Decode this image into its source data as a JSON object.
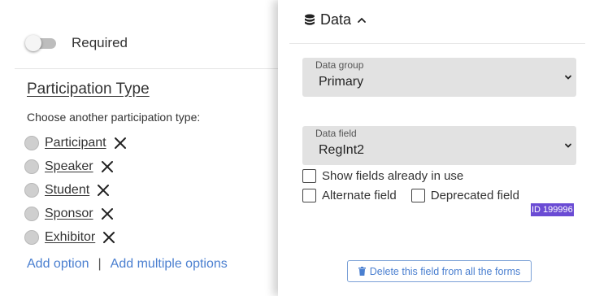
{
  "left_panel": {
    "required_label": "Required",
    "required_on": false,
    "section_title": "Participation Type",
    "hint": "Choose another participation type:",
    "participation_types": [
      {
        "label": "Participant"
      },
      {
        "label": "Speaker"
      },
      {
        "label": "Student"
      },
      {
        "label": "Sponsor"
      },
      {
        "label": "Exhibitor"
      }
    ],
    "add_option": "Add option",
    "separator": "|",
    "add_multiple": "Add multiple options"
  },
  "right_panel": {
    "section_label": "Data",
    "section_icon": "database-icon",
    "data_group": {
      "label": "Data group",
      "value": "Primary"
    },
    "data_field": {
      "label": "Data field",
      "value": "RegInt2"
    },
    "checkboxes": {
      "show_in_use": "Show fields already in use",
      "alternate": "Alternate field",
      "deprecated": "Deprecated field"
    },
    "id_badge": "ID 199996",
    "delete_button": "Delete this field from all the forms"
  },
  "colors": {
    "link": "#4a7fd0",
    "badge": "#6a4bd4",
    "select_bg": "#e2e2e2"
  }
}
